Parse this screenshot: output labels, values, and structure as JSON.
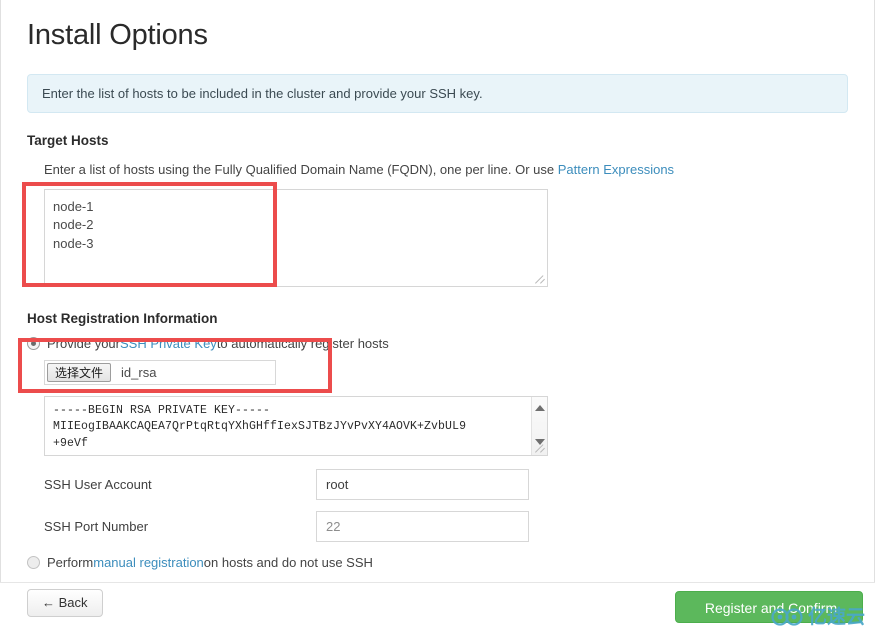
{
  "page": {
    "title": "Install Options",
    "info_message": "Enter the list of hosts to be included in the cluster and provide your SSH key."
  },
  "target_hosts": {
    "section_title": "Target Hosts",
    "hint_prefix": "Enter a list of hosts using the Fully Qualified Domain Name (FQDN), one per line. Or use ",
    "hint_link": "Pattern Expressions",
    "hosts_value": "node-1\nnode-2\nnode-3",
    "hosts_placeholder": ""
  },
  "host_registration": {
    "section_title": "Host Registration Information",
    "ssh_option": {
      "selected": true,
      "text_before": "Provide your ",
      "link": "SSH Private Key",
      "text_after": " to automatically register hosts"
    },
    "file_picker": {
      "button_label": "选择文件",
      "file_name": "id_rsa"
    },
    "private_key_value": "-----BEGIN RSA PRIVATE KEY-----\nMIIEogIBAAKCAQEA7QrPtqRtqYXhGHffIexSJTBzJYvPvXY4AOVK+ZvbUL9\n+9eVf",
    "ssh_user_account": {
      "label": "SSH User Account",
      "value": "root"
    },
    "ssh_port_number": {
      "label": "SSH Port Number",
      "value": "22"
    },
    "manual_option": {
      "selected": false,
      "text_before": "Perform ",
      "link": "manual registration",
      "text_after": " on hosts and do not use SSH"
    }
  },
  "footer": {
    "back_label": "← Back",
    "register_label": "Register and Confirm"
  },
  "watermark": {
    "text": "亿速云",
    "logo_name": "yisuyun-logo-icon"
  },
  "colors": {
    "accent_link": "#3c8dbc",
    "primary_button": "#5cb85c",
    "annotation": "#ec4c4c",
    "info_bg": "#e9f4f9"
  }
}
